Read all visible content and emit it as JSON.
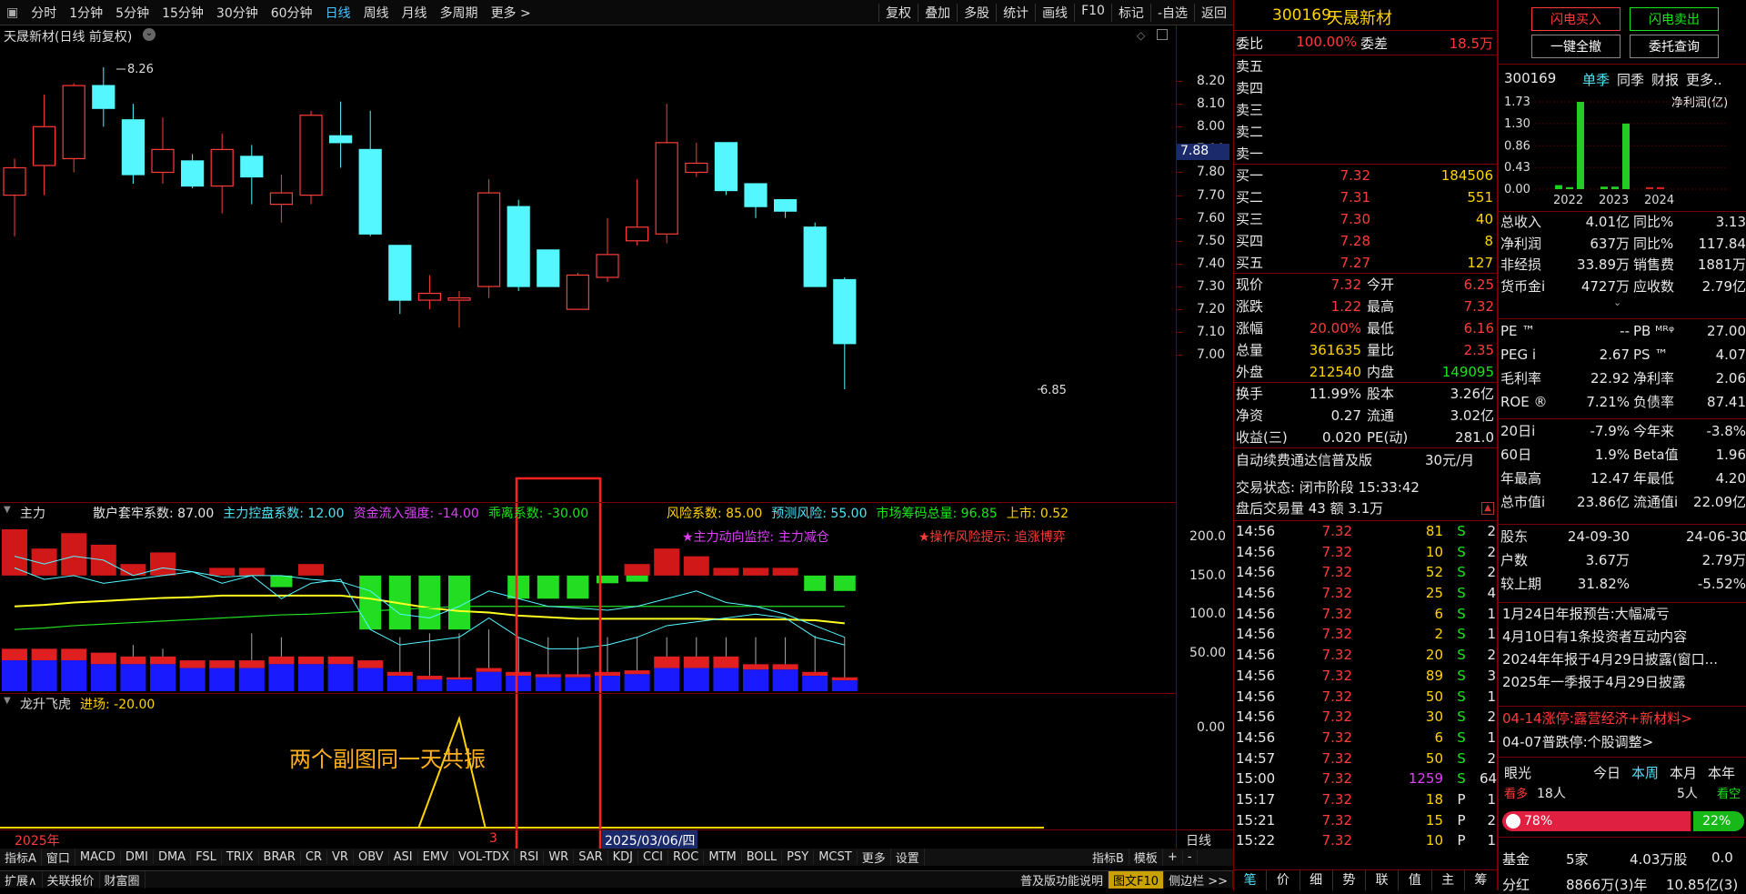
{
  "toolbar": {
    "periods": [
      "分时",
      "1分钟",
      "5分钟",
      "15分钟",
      "30分钟",
      "60分钟",
      "日线",
      "周线",
      "月线",
      "多周期",
      "更多 >"
    ],
    "active": "日线",
    "right": [
      "复权",
      "叠加",
      "多股",
      "统计",
      "画线",
      "F10",
      "标记",
      "-自选",
      "返回"
    ]
  },
  "chart": {
    "title": "天晟新材(日线 前复权)",
    "high_label": "8.26",
    "low_label": "6.85",
    "cur_price": "7.88",
    "price_ticks": [
      "8.20",
      "8.10",
      "8.00",
      "7.90",
      "7.80",
      "7.70",
      "7.60",
      "7.50",
      "7.40",
      "7.30",
      "7.20",
      "7.10",
      "7.00"
    ],
    "candles": [
      [
        7.7,
        7.82,
        7.52,
        7.86,
        "up"
      ],
      [
        7.83,
        8.0,
        7.7,
        8.14,
        "up"
      ],
      [
        7.86,
        8.18,
        7.8,
        8.19,
        "up"
      ],
      [
        8.18,
        8.08,
        8.0,
        8.26,
        "dn"
      ],
      [
        8.03,
        7.79,
        7.75,
        8.1,
        "dn"
      ],
      [
        7.8,
        7.9,
        7.75,
        8.04,
        "up"
      ],
      [
        7.85,
        7.74,
        7.73,
        7.88,
        "dn"
      ],
      [
        7.74,
        7.9,
        7.62,
        7.97,
        "up"
      ],
      [
        7.87,
        7.78,
        7.66,
        7.92,
        "dn"
      ],
      [
        7.66,
        7.71,
        7.58,
        7.79,
        "up"
      ],
      [
        7.7,
        8.05,
        7.66,
        8.07,
        "up"
      ],
      [
        7.96,
        7.93,
        7.82,
        8.11,
        "dn"
      ],
      [
        7.9,
        7.53,
        7.52,
        8.07,
        "dn"
      ],
      [
        7.48,
        7.24,
        7.18,
        7.48,
        "dn"
      ],
      [
        7.24,
        7.27,
        7.2,
        7.35,
        "up"
      ],
      [
        7.24,
        7.25,
        7.12,
        7.28,
        "up"
      ],
      [
        7.3,
        7.71,
        7.25,
        7.77,
        "up"
      ],
      [
        7.65,
        7.3,
        7.28,
        7.68,
        "dn"
      ],
      [
        7.46,
        7.3,
        7.3,
        7.46,
        "dn"
      ],
      [
        7.2,
        7.35,
        7.22,
        7.36,
        "up"
      ],
      [
        7.34,
        7.44,
        7.32,
        7.6,
        "up"
      ],
      [
        7.5,
        7.56,
        7.48,
        7.77,
        "up"
      ],
      [
        7.53,
        7.93,
        7.49,
        8.1,
        "up"
      ],
      [
        7.8,
        7.84,
        7.78,
        7.93,
        "up"
      ],
      [
        7.93,
        7.72,
        7.7,
        7.93,
        "dn"
      ],
      [
        7.75,
        7.65,
        7.6,
        7.75,
        "dn"
      ],
      [
        7.68,
        7.63,
        7.6,
        7.68,
        "dn"
      ],
      [
        7.56,
        7.3,
        7.3,
        7.58,
        "dn"
      ],
      [
        7.33,
        7.05,
        6.85,
        7.34,
        "dn"
      ]
    ]
  },
  "ind1": {
    "name": "主力",
    "labels": [
      [
        "散户套牢系数: 87.00",
        "wh"
      ],
      [
        "主力控盘系数: 12.00",
        "cy"
      ],
      [
        "资金流入强度: -14.00",
        "mag"
      ],
      [
        "乖离系数: -30.00",
        "grn"
      ]
    ],
    "labels2": [
      [
        "风险系数: 85.00",
        "yel"
      ],
      [
        "预测风险: 55.00",
        "cy"
      ],
      [
        "市场筹码总量: 96.85",
        "grn"
      ],
      [
        "上市: 0.52",
        "yel"
      ]
    ],
    "hint1": "★主力动向监控: 主力减仓",
    "hint2": "★操作风险提示: 追涨博弈",
    "ticks": [
      "200.0",
      "150.0",
      "100.0",
      "50.00"
    ]
  },
  "ind2": {
    "name": "龙升飞虎",
    "label": "进场: -20.00",
    "tick": "0.00"
  },
  "annotation": "两个副图同一天共振",
  "date_axis": {
    "year": "2025年",
    "mark": "3",
    "date": "2025/03/06/四",
    "period": "日线"
  },
  "bottom_tabs": [
    "指标A",
    "窗口",
    "MACD",
    "DMI",
    "DMA",
    "FSL",
    "TRIX",
    "BRAR",
    "CR",
    "VR",
    "OBV",
    "ASI",
    "EMV",
    "VOL-TDX",
    "RSI",
    "WR",
    "SAR",
    "KDJ",
    "CCI",
    "ROC",
    "MTM",
    "BOLL",
    "PSY",
    "MCST",
    "更多",
    "设置"
  ],
  "bottom_right": [
    "指标B",
    "模板",
    "+",
    "-"
  ],
  "status": {
    "left": [
      "扩展∧",
      "关联报价",
      "财富圈"
    ],
    "right": [
      "普及版功能说明",
      "图文F10",
      "侧边栏 >>"
    ]
  },
  "quote": {
    "code": "300169",
    "name": "天晟新材",
    "weibi_label": "委比",
    "weibi": "100.00%",
    "weicha_label": "委差",
    "weicha": "18.5万",
    "sell": [
      "卖五",
      "卖四",
      "卖三",
      "卖二",
      "卖一"
    ],
    "buy": [
      [
        "买一",
        "7.32",
        "184506"
      ],
      [
        "买二",
        "7.31",
        "551"
      ],
      [
        "买三",
        "7.30",
        "40"
      ],
      [
        "买四",
        "7.28",
        "8"
      ],
      [
        "买五",
        "7.27",
        "127"
      ]
    ],
    "stats": [
      [
        "现价",
        "7.32",
        "今开",
        "6.25"
      ],
      [
        "涨跌",
        "1.22",
        "最高",
        "7.32"
      ],
      [
        "涨幅",
        "20.00%",
        "最低",
        "6.16"
      ],
      [
        "总量",
        "361635",
        "量比",
        "2.35"
      ],
      [
        "外盘",
        "212540",
        "内盘",
        "149095"
      ]
    ],
    "stats2": [
      [
        "换手",
        "11.99%",
        "股本",
        "3.26亿"
      ],
      [
        "净资",
        "0.27",
        "流通",
        "3.02亿"
      ],
      [
        "收益(三)",
        "0.020",
        "PE(动)",
        "281.0"
      ]
    ],
    "ad": "自动续费通达信普及版",
    "ad_price": "30元/月",
    "state": "交易状态: 闭市阶段 15:33:42",
    "after": "盘后交易量 43 额 3.1万",
    "ticks": [
      [
        "14:56",
        "7.32",
        "81",
        "S",
        "2"
      ],
      [
        "14:56",
        "7.32",
        "10",
        "S",
        "2"
      ],
      [
        "14:56",
        "7.32",
        "52",
        "S",
        "2"
      ],
      [
        "14:56",
        "7.32",
        "25",
        "S",
        "4"
      ],
      [
        "14:56",
        "7.32",
        "6",
        "S",
        "1"
      ],
      [
        "14:56",
        "7.32",
        "2",
        "S",
        "1"
      ],
      [
        "14:56",
        "7.32",
        "20",
        "S",
        "2"
      ],
      [
        "14:56",
        "7.32",
        "89",
        "S",
        "3"
      ],
      [
        "14:56",
        "7.32",
        "50",
        "S",
        "1"
      ],
      [
        "14:56",
        "7.32",
        "30",
        "S",
        "2"
      ],
      [
        "14:56",
        "7.32",
        "6",
        "S",
        "1"
      ],
      [
        "14:57",
        "7.32",
        "50",
        "S",
        "2"
      ],
      [
        "15:00",
        "7.32",
        "1259",
        "S",
        "64"
      ],
      [
        "15:17",
        "7.32",
        "18",
        "P",
        "1"
      ],
      [
        "15:21",
        "7.32",
        "15",
        "P",
        "2"
      ],
      [
        "15:22",
        "7.32",
        "10",
        "P",
        "1"
      ]
    ],
    "tabs": [
      "笔",
      "价",
      "细",
      "势",
      "联",
      "值",
      "主",
      "筹"
    ]
  },
  "fin": {
    "btn_buy": "闪电买入",
    "btn_sell": "闪电卖出",
    "btn_cancel": "一键全撤",
    "btn_query": "委托查询",
    "code": "300169",
    "menu": [
      "单季",
      "同季",
      "财报",
      "更多.."
    ],
    "unit": "净利润(亿)",
    "yticks": [
      "1.73",
      "1.30",
      "0.86",
      "0.43",
      "0.00"
    ],
    "years": [
      "2022",
      "2023",
      "2024"
    ],
    "rows1": [
      [
        "总收入",
        "4.01亿",
        "同比%",
        "3.13"
      ],
      [
        "净利润",
        "637万",
        "同比%",
        "117.84"
      ],
      [
        "非经损",
        "33.89万",
        "销售费",
        "1881万"
      ],
      [
        "货币金i",
        "4727万",
        "应收数",
        "2.79亿"
      ]
    ],
    "rows2": [
      [
        "PE ™",
        "--",
        "PB ᴹᴿᵠ",
        "27.00"
      ],
      [
        "PEG i",
        "2.67",
        "PS ™",
        "4.07"
      ],
      [
        "毛利率",
        "22.92",
        "净利率",
        "2.06"
      ],
      [
        "ROE ®",
        "7.21%",
        "负债率",
        "87.41"
      ]
    ],
    "rows3": [
      [
        "20日i",
        "-7.9%",
        "今年来",
        "-3.8%"
      ],
      [
        "60日",
        "1.9%",
        "Beta值",
        "1.96"
      ],
      [
        "年最高",
        "12.47",
        "年最低",
        "4.20"
      ],
      [
        "总市值i",
        "23.86亿",
        "流通值i",
        "22.09亿"
      ]
    ],
    "rows4": [
      [
        "股东",
        "24-09-30",
        "",
        "24-06-30"
      ],
      [
        "户数",
        "3.67万",
        "",
        "2.79万"
      ],
      [
        "较上期",
        "31.82%",
        "",
        "-5.52%"
      ]
    ],
    "news": [
      "1月24日年报预告:大幅减亏",
      "4月10日有1条投资者互动内容",
      "2024年年报于4月29日披露(窗口...",
      "2025年一季报于4月29日披露"
    ],
    "news2": [
      "04-14涨停:露营经济+新材料>",
      "04-07普跌停:个股调整>"
    ],
    "eye": {
      "label": "眼光",
      "tabs": [
        "今日",
        "本周",
        "本月",
        "本年"
      ],
      "active": "本周",
      "kz": "看多",
      "kz_n": "18人",
      "kk_n": "5人",
      "kk": "看空",
      "pct_l": "78%",
      "pct_r": "22%"
    },
    "fund": [
      "基金",
      "5家",
      "4.03万股",
      "0.0"
    ],
    "last": [
      "分红",
      "8866万(3)年",
      "10.85亿(3)"
    ]
  }
}
